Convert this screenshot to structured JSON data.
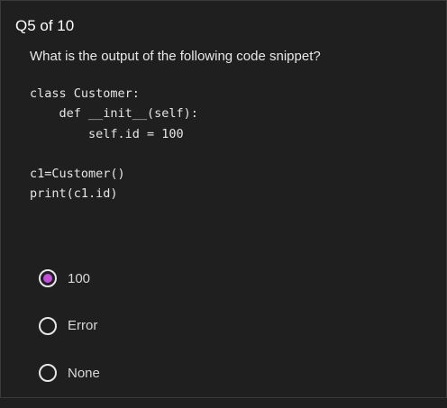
{
  "question": {
    "counter": "Q5 of 10",
    "text": "What is the output of the following code snippet?"
  },
  "code": {
    "lines": [
      "class Customer:",
      "    def __init__(self):",
      "        self.id = 100",
      "",
      "c1=Customer()",
      "print(c1.id)"
    ]
  },
  "options": [
    {
      "label": "100",
      "selected": true
    },
    {
      "label": "Error",
      "selected": false
    },
    {
      "label": "None",
      "selected": false
    }
  ],
  "colors": {
    "background": "#1f1f1f",
    "accent": "#c34fdc"
  }
}
